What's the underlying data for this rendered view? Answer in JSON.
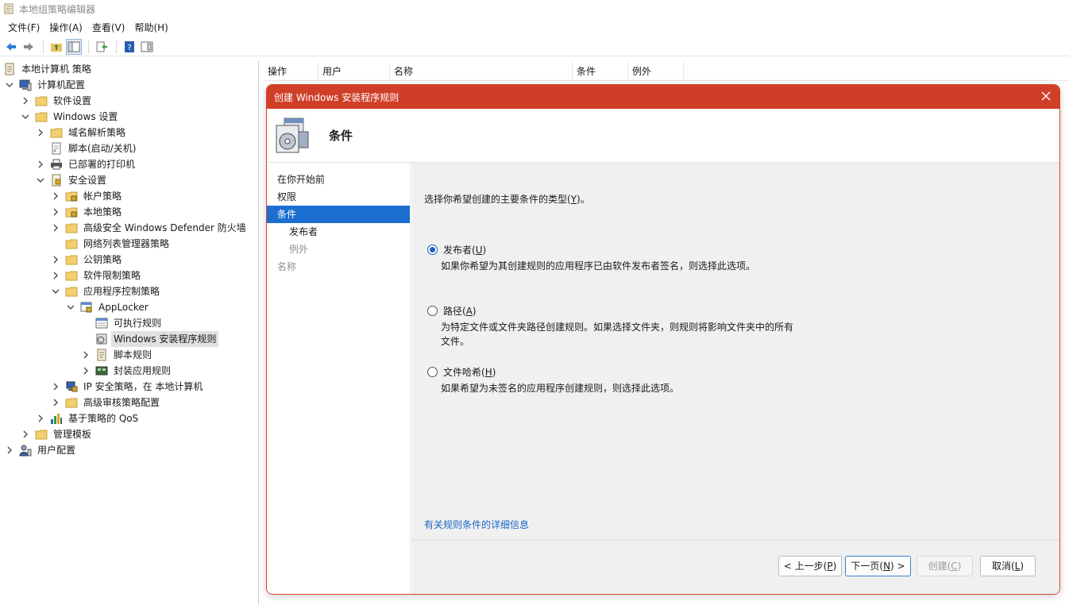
{
  "window": {
    "title": "本地组策略编辑器"
  },
  "menu": [
    {
      "label": "文件(F)"
    },
    {
      "label": "操作(A)"
    },
    {
      "label": "查看(V)"
    },
    {
      "label": "帮助(H)"
    }
  ],
  "toolbar": {
    "buttons": [
      "back-icon",
      "forward-icon",
      "up-folder-icon",
      "show-tree-icon",
      "export-list-icon",
      "help-icon",
      "properties-icon"
    ]
  },
  "tree": {
    "items": [
      {
        "label": "本地计算机 策略",
        "icon": "policy-icon"
      },
      {
        "label": "计算机配置",
        "icon": "computer-icon"
      },
      {
        "label": "软件设置",
        "icon": "folder-icon"
      },
      {
        "label": "Windows 设置",
        "icon": "folder-icon"
      },
      {
        "label": "域名解析策略",
        "icon": "folder-icon"
      },
      {
        "label": "脚本(启动/关机)",
        "icon": "script-icon"
      },
      {
        "label": "已部署的打印机",
        "icon": "printer-icon"
      },
      {
        "label": "安全设置",
        "icon": "security-icon"
      },
      {
        "label": "帐户策略",
        "icon": "folder-lock-icon"
      },
      {
        "label": "本地策略",
        "icon": "folder-lock-icon"
      },
      {
        "label": "高级安全 Windows Defender 防火墙",
        "icon": "folder-icon"
      },
      {
        "label": "网络列表管理器策略",
        "icon": "folder-icon"
      },
      {
        "label": "公钥策略",
        "icon": "folder-icon"
      },
      {
        "label": "软件限制策略",
        "icon": "folder-icon"
      },
      {
        "label": "应用程序控制策略",
        "icon": "folder-icon"
      },
      {
        "label": "AppLocker",
        "icon": "applocker-icon"
      },
      {
        "label": "可执行规则",
        "icon": "rule-icon"
      },
      {
        "label": "Windows 安装程序规则",
        "icon": "installer-icon"
      },
      {
        "label": "脚本规则",
        "icon": "script-rule-icon"
      },
      {
        "label": "封装应用规则",
        "icon": "packaged-app-icon"
      },
      {
        "label": "IP 安全策略，在 本地计算机",
        "icon": "ipsec-icon"
      },
      {
        "label": "高级审核策略配置",
        "icon": "folder-icon"
      },
      {
        "label": "基于策略的 QoS",
        "icon": "qos-chart-icon"
      },
      {
        "label": "管理模板",
        "icon": "folder-icon"
      },
      {
        "label": "用户配置",
        "icon": "user-icon"
      }
    ]
  },
  "list_columns": [
    "操作",
    "用户",
    "名称",
    "条件",
    "例外"
  ],
  "dialog": {
    "title": "创建 Windows 安装程序规则",
    "heading": "条件",
    "nav": [
      "在你开始前",
      "权限",
      "条件",
      "发布者",
      "例外",
      "名称"
    ],
    "prompt_text": "选择你希望创建的主要条件的类型(",
    "prompt_key": "Y",
    "prompt_tail": ")。",
    "options": [
      {
        "label": "发布者(",
        "key": "U",
        "tail": ")",
        "desc": "如果你希望为其创建规则的应用程序已由软件发布者签名，则选择此选项。",
        "checked": true
      },
      {
        "label": "路径(",
        "key": "A",
        "tail": ")",
        "desc": "为特定文件或文件夹路径创建规则。如果选择文件夹，则规则将影响文件夹中的所有文件。",
        "checked": false
      },
      {
        "label": "文件哈希(",
        "key": "H",
        "tail": ")",
        "desc": "如果希望为未签名的应用程序创建规则，则选择此选项。",
        "checked": false
      }
    ],
    "help_link": "有关规则条件的详细信息",
    "buttons": {
      "previous": {
        "pre": "< 上一步(",
        "key": "P",
        "post": ")"
      },
      "next": {
        "pre": "下一页(",
        "key": "N",
        "post": ") >"
      },
      "create": {
        "pre": "创建(",
        "key": "C",
        "post": ")"
      },
      "cancel": {
        "pre": "取消(",
        "key": "L",
        "post": ")"
      }
    }
  },
  "colors": {
    "dialog_title_bg": "#cf3f28",
    "nav_active_bg": "#1c6fd1",
    "link": "#1a66c2",
    "folder": "#e8c15a"
  }
}
